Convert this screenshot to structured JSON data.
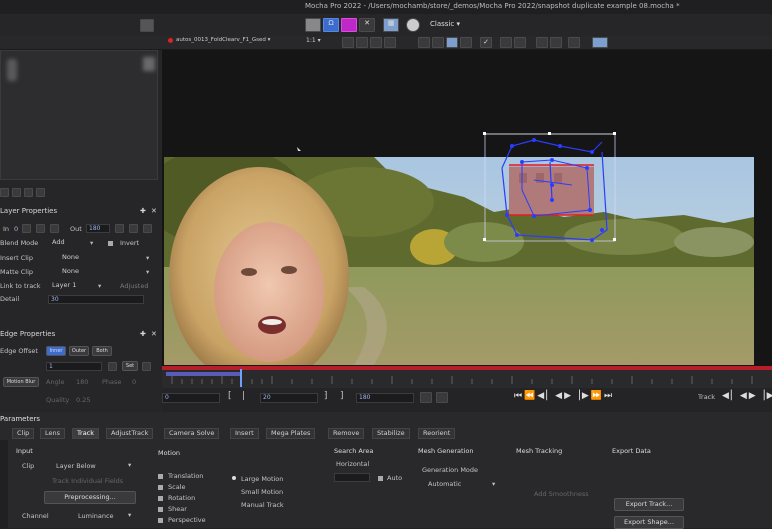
{
  "window": {
    "title": "Mocha Pro 2022 - /Users/mochamb/store/_demos/Mocha Pro 2022/snapshot duplicate example 08.mocha *"
  },
  "toolbar": {
    "workspace": "Classic",
    "clip_name": "autos_0013_FoldClearv_F1_Gsed",
    "zoom": "1:1"
  },
  "layer_properties": {
    "header": "Layer Properties",
    "in_label": "In",
    "in_value": "0",
    "out_label": "Out",
    "out_value": "180",
    "blend_mode_label": "Blend Mode",
    "blend_mode_value": "Add",
    "invert_label": "Invert",
    "insert_clip_label": "Insert Clip",
    "insert_clip_value": "None",
    "matte_clip_label": "Matte Clip",
    "matte_clip_value": "None",
    "link_to_track_label": "Link to track",
    "link_to_track_value": "Layer 1",
    "adjusted_label": "Adjusted",
    "detail_label": "Detail",
    "detail_value": "30"
  },
  "edge_properties": {
    "header": "Edge Properties",
    "edge_offset_label": "Edge Offset",
    "opts": [
      "Inner",
      "Outer",
      "Both"
    ],
    "value": "1",
    "set_label": "Set",
    "motion_blur_label": "Motion Blur",
    "angle_label": "Angle",
    "angle_value": "180",
    "phase_label": "Phase",
    "phase_value": "0",
    "quality_label": "Quality",
    "quality_value": "0.25"
  },
  "transport": {
    "in_frame": "0",
    "current_frame": "20",
    "out_frame": "180",
    "track_label": "Track"
  },
  "parameters": {
    "header": "Parameters",
    "tabs": [
      "Clip",
      "Lens",
      "Track",
      "AdjustTrack",
      "Camera Solve",
      "Insert",
      "Mega Plates",
      "Remove",
      "Stabilize",
      "Reorient"
    ],
    "active_tab": "Track",
    "input_label": "Input",
    "clip_label": "Clip",
    "clip_value": "Layer Below",
    "track_individual_fields": "Track Individual Fields",
    "preprocessing": "Preprocessing...",
    "channel_label": "Channel",
    "channel_value": "Luminance",
    "motion_label": "Motion",
    "motion_opts": [
      "Translation",
      "Scale",
      "Rotation",
      "Shear",
      "Perspective"
    ],
    "search_area_label": "Search Area",
    "horizontal_label": "Horizontal",
    "auto_label": "Auto",
    "large_motion": "Large Motion",
    "small_motion": "Small Motion",
    "manual_track": "Manual Track",
    "mesh_generation_label": "Mesh Generation",
    "generation_mode_label": "Generation Mode",
    "generation_mode_value": "Automatic",
    "mesh_tracking_label": "Mesh Tracking",
    "export_data_label": "Export Data",
    "export_track": "Export Track...",
    "export_shape": "Export Shape...",
    "add_smoothness": "Add Smoothness"
  },
  "colors": {
    "accent": "#3b6dd1",
    "selection": "#c027c9",
    "spline": "#2a3cff",
    "timeline_marker": "#b81e2a"
  }
}
